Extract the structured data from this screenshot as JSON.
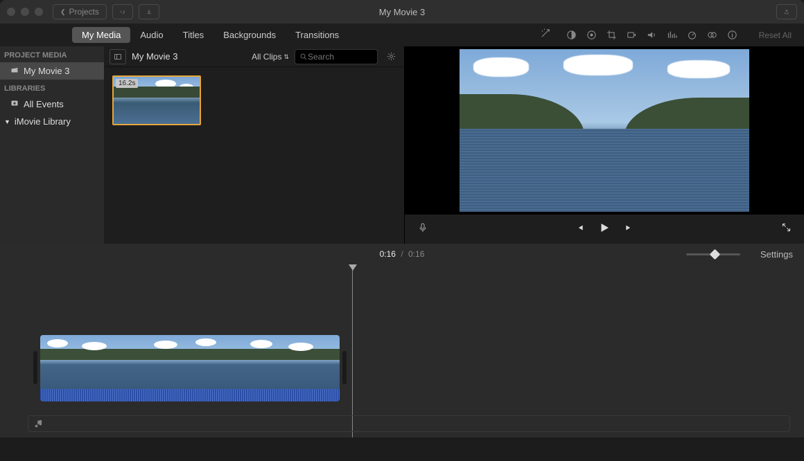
{
  "titlebar": {
    "projects_label": "Projects",
    "window_title": "My Movie 3"
  },
  "tabs": {
    "my_media": "My Media",
    "audio": "Audio",
    "titles": "Titles",
    "backgrounds": "Backgrounds",
    "transitions": "Transitions"
  },
  "adjust": {
    "reset_all": "Reset All"
  },
  "sidebar": {
    "project_media_heading": "PROJECT MEDIA",
    "project_item": "My Movie 3",
    "libraries_heading": "LIBRARIES",
    "all_events": "All Events",
    "imovie_library": "iMovie Library"
  },
  "browser": {
    "breadcrumb": "My Movie 3",
    "filter_label": "All Clips",
    "search_placeholder": "Search",
    "clip_duration": "16.2s"
  },
  "timebar": {
    "current": "0:16",
    "sep": "/",
    "total": "0:16",
    "settings": "Settings"
  }
}
